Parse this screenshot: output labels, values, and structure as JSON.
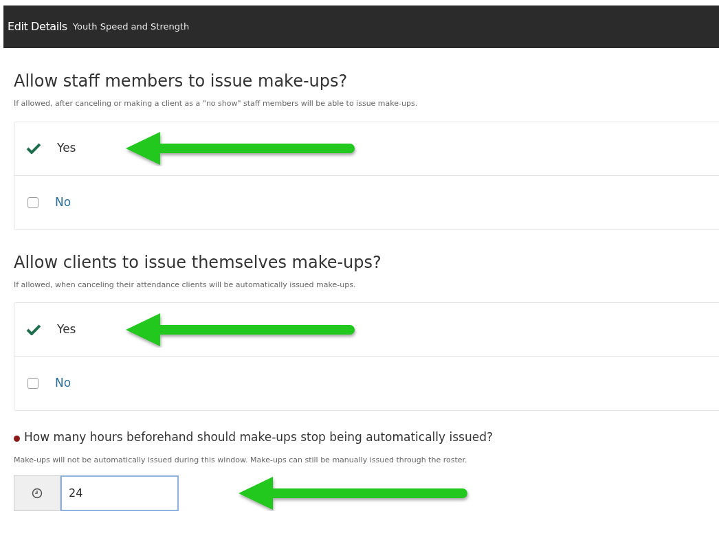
{
  "header": {
    "title": "Edit Details",
    "subtitle": "Youth Speed and Strength"
  },
  "questions": [
    {
      "title": "Allow staff members to issue make-ups?",
      "description": "If allowed, after canceling or making a client as a \"no show\" staff members will be able to issue make-ups.",
      "options": [
        {
          "label": "Yes",
          "checked": true,
          "arrow": true
        },
        {
          "label": "No",
          "checked": false,
          "arrow": false
        }
      ]
    },
    {
      "title": "Allow clients to issue themselves make-ups?",
      "description": "If allowed, when canceling their attendance clients will be automatically issued make-ups.",
      "options": [
        {
          "label": "Yes",
          "checked": true,
          "arrow": true
        },
        {
          "label": "No",
          "checked": false,
          "arrow": false
        }
      ]
    }
  ],
  "hours": {
    "required": true,
    "title": "How many hours beforehand should make-ups stop being automatically issued?",
    "description": "Make-ups will not be automatically issued during this window. Make-ups can still be manually issued through the roster.",
    "value": "24",
    "arrow": true
  }
}
